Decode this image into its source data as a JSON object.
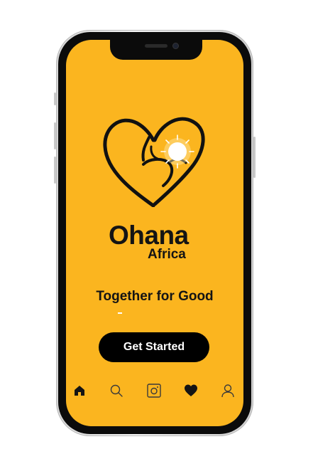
{
  "app": {
    "brand_line1": "Ohana",
    "brand_line2": "Africa",
    "tagline": "Together for Good",
    "cta_label": "Get Started"
  },
  "nav": {
    "items": [
      {
        "icon": "home-icon",
        "active": true
      },
      {
        "icon": "search-icon",
        "active": false
      },
      {
        "icon": "instagram-icon",
        "active": false
      },
      {
        "icon": "heart-icon",
        "active": true
      },
      {
        "icon": "profile-icon",
        "active": false
      }
    ]
  },
  "colors": {
    "background": "#fbb51f",
    "text": "#141414",
    "button": "#000000",
    "button_text": "#ffffff"
  }
}
